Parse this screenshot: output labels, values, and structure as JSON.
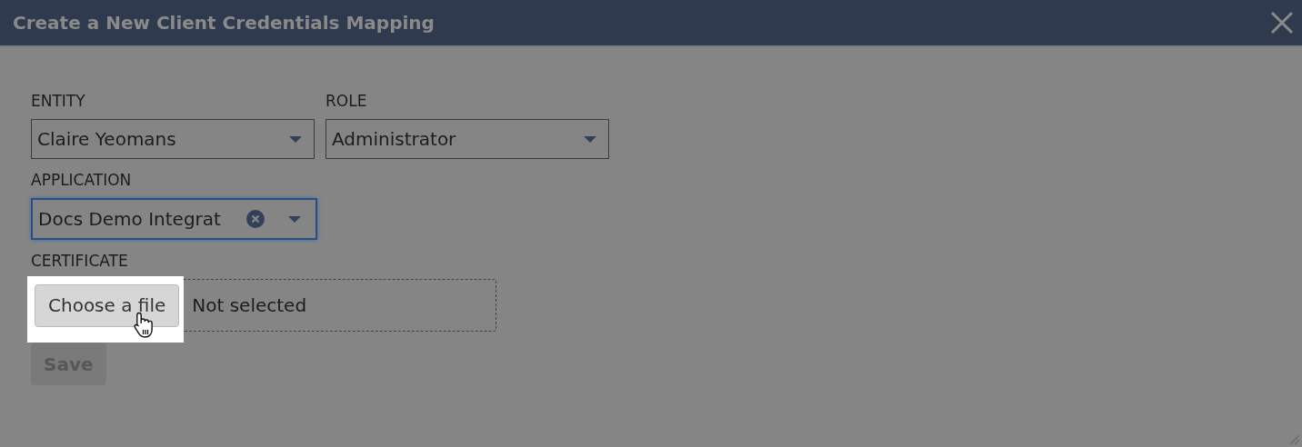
{
  "dialog": {
    "title": "Create a New Client Credentials Mapping"
  },
  "rows": [
    [
      {
        "kind": "select",
        "label": "ENTITY",
        "value": "Claire Yeomans",
        "focused": false,
        "clearable": false
      },
      {
        "kind": "select",
        "label": "ROLE",
        "value": "Administrator",
        "focused": false,
        "clearable": false
      }
    ],
    [
      {
        "kind": "select",
        "label": "APPLICATION",
        "value": "Docs Demo Integrat",
        "focused": true,
        "clearable": true
      }
    ],
    [
      {
        "kind": "file",
        "label": "CERTIFICATE",
        "button": "Choose a file",
        "status": "Not selected",
        "highlighted": true
      }
    ]
  ],
  "save_button": {
    "label": "Save",
    "disabled": true
  }
}
